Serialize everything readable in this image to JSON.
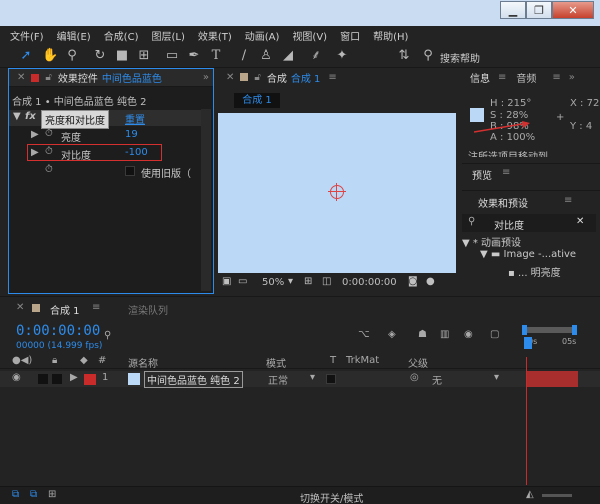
{
  "menu": [
    "文件(F)",
    "编辑(E)",
    "合成(C)",
    "图层(L)",
    "效果(T)",
    "动画(A)",
    "视图(V)",
    "窗口",
    "帮助(H)"
  ],
  "toolbar": {
    "search_label": "搜索帮助"
  },
  "effect_controls": {
    "tab_label": "效果控件",
    "tab_layer": "中间色品蓝色",
    "breadcrumb": "合成 1 • 中间色品蓝色 纯色 2",
    "fx_label": "fx",
    "effect_name": "亮度和对比度",
    "reset": "重置",
    "brightness_label": "亮度",
    "brightness_value": "19",
    "contrast_label": "对比度",
    "contrast_value": "-100",
    "legacy_label": "使用旧版（"
  },
  "composition": {
    "tab_label": "合成",
    "tab_name": "合成 1",
    "sub_tab": "合成 1",
    "zoom": "50%",
    "timecode": "0:00:00:00"
  },
  "info": {
    "tab_info": "信息",
    "tab_audio": "音频",
    "h": "H : 215°",
    "s": "S : 28%",
    "b": "B : 98%",
    "a": "A : 100%",
    "x": "X : 72",
    "y": "Y : 4",
    "truncated_text": "注所选项目移动到",
    "preview_tab": "预览",
    "effects_tab": "效果和预设",
    "search_value": "对比度",
    "tree_root": "* 动画预设",
    "tree_child": "Image -...ative",
    "tree_leaf": "... 明亮度"
  },
  "timeline": {
    "tab_comp": "合成 1",
    "tab_render": "渲染队列",
    "timecode": "0:00:00:00",
    "frames": "00000 (14.999 fps)",
    "col_source": "源名称",
    "col_mode": "模式",
    "col_t": "T",
    "col_trkmat": "TrkMat",
    "col_parent": "父级",
    "ruler_start": "0s",
    "ruler_end": "05s",
    "layer_num": "1",
    "layer_name": "中间色品蓝色 纯色 2",
    "layer_mode": "正常",
    "layer_parent": "无",
    "status_text": "切换开关/模式"
  },
  "colors": {
    "accent": "#2d8ceb",
    "comp_bg": "#bcd8f7",
    "layer_label": "#c92a2a",
    "highlight_box": "#d43030"
  }
}
